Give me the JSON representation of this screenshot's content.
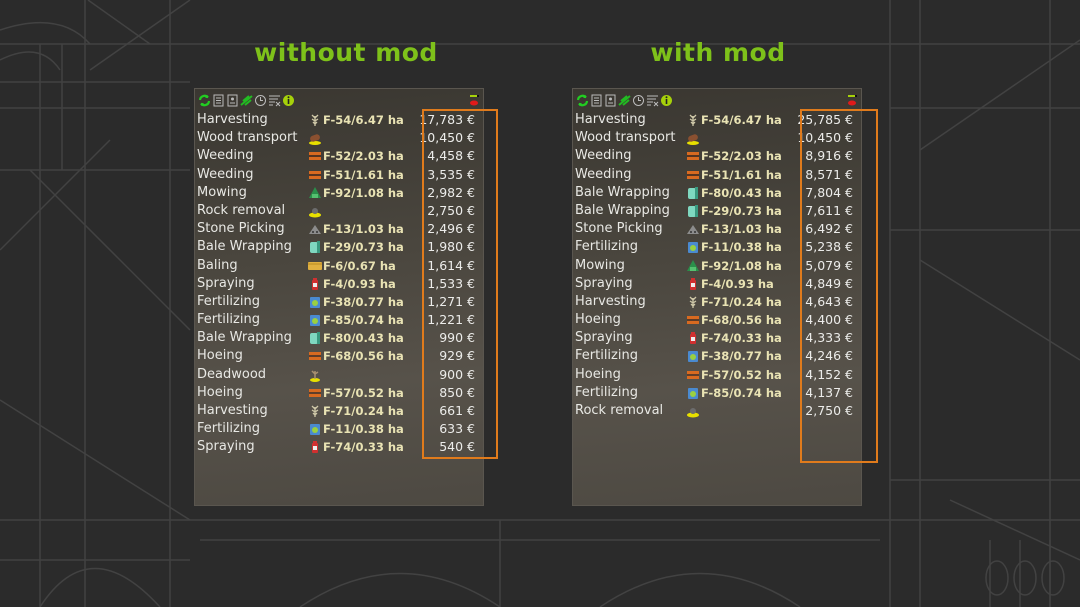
{
  "titles": {
    "left": "without mod",
    "right": "with mod"
  },
  "colors": {
    "title": "#7ec11a",
    "highlight": "#e07b1c",
    "field_text": "#e9e3b4",
    "toolbar_accent": "#22cc22",
    "info": "#a6d10a"
  },
  "toolbar_icons": [
    "refresh-icon",
    "list-icon",
    "contract-icon",
    "crop-icon",
    "clock-icon",
    "clear-filter-icon",
    "info-icon"
  ],
  "without_mod": {
    "rows": [
      {
        "task": "Harvesting",
        "icon": "harvest",
        "field": "F-54/6.47 ha",
        "amount": "17,783 €"
      },
      {
        "task": "Wood transport",
        "icon": "wood",
        "field": "",
        "amount": "10,450 €"
      },
      {
        "task": "Weeding",
        "icon": "weed",
        "field": "F-52/2.03 ha",
        "amount": "4,458 €"
      },
      {
        "task": "Weeding",
        "icon": "weed",
        "field": "F-51/1.61 ha",
        "amount": "3,535 €"
      },
      {
        "task": "Mowing",
        "icon": "mow",
        "field": "F-92/1.08 ha",
        "amount": "2,982 €"
      },
      {
        "task": "Rock removal",
        "icon": "rock",
        "field": "",
        "amount": "2,750 €"
      },
      {
        "task": "Stone Picking",
        "icon": "stone",
        "field": "F-13/1.03 ha",
        "amount": "2,496 €"
      },
      {
        "task": "Bale Wrapping",
        "icon": "wrap",
        "field": "F-29/0.73 ha",
        "amount": "1,980 €"
      },
      {
        "task": "Baling",
        "icon": "bale",
        "field": "F-6/0.67 ha",
        "amount": "1,614 €"
      },
      {
        "task": "Spraying",
        "icon": "spray",
        "field": "F-4/0.93 ha",
        "amount": "1,533 €"
      },
      {
        "task": "Fertilizing",
        "icon": "fert",
        "field": "F-38/0.77 ha",
        "amount": "1,271 €"
      },
      {
        "task": "Fertilizing",
        "icon": "fert",
        "field": "F-85/0.74 ha",
        "amount": "1,221 €"
      },
      {
        "task": "Bale Wrapping",
        "icon": "wrap",
        "field": "F-80/0.43 ha",
        "amount": "990 €"
      },
      {
        "task": "Hoeing",
        "icon": "weed",
        "field": "F-68/0.56 ha",
        "amount": "929 €"
      },
      {
        "task": "Deadwood",
        "icon": "deadwood",
        "field": "",
        "amount": "900 €"
      },
      {
        "task": "Hoeing",
        "icon": "weed",
        "field": "F-57/0.52 ha",
        "amount": "850 €"
      },
      {
        "task": "Harvesting",
        "icon": "harvest",
        "field": "F-71/0.24 ha",
        "amount": "661 €"
      },
      {
        "task": "Fertilizing",
        "icon": "fert",
        "field": "F-11/0.38 ha",
        "amount": "633 €"
      },
      {
        "task": "Spraying",
        "icon": "spray",
        "field": "F-74/0.33 ha",
        "amount": "540 €"
      }
    ]
  },
  "with_mod": {
    "rows": [
      {
        "task": "Harvesting",
        "icon": "harvest",
        "field": "F-54/6.47 ha",
        "amount": "25,785 €"
      },
      {
        "task": "Wood transport",
        "icon": "wood",
        "field": "",
        "amount": "10,450 €"
      },
      {
        "task": "Weeding",
        "icon": "weed",
        "field": "F-52/2.03 ha",
        "amount": "8,916 €"
      },
      {
        "task": "Weeding",
        "icon": "weed",
        "field": "F-51/1.61 ha",
        "amount": "8,571 €"
      },
      {
        "task": "Bale Wrapping",
        "icon": "wrap",
        "field": "F-80/0.43 ha",
        "amount": "7,804 €"
      },
      {
        "task": "Bale Wrapping",
        "icon": "wrap",
        "field": "F-29/0.73 ha",
        "amount": "7,611 €"
      },
      {
        "task": "Stone Picking",
        "icon": "stone",
        "field": "F-13/1.03 ha",
        "amount": "6,492 €"
      },
      {
        "task": "Fertilizing",
        "icon": "fert",
        "field": "F-11/0.38 ha",
        "amount": "5,238 €"
      },
      {
        "task": "Mowing",
        "icon": "mow",
        "field": "F-92/1.08 ha",
        "amount": "5,079 €"
      },
      {
        "task": "Spraying",
        "icon": "spray",
        "field": "F-4/0.93 ha",
        "amount": "4,849 €"
      },
      {
        "task": "Harvesting",
        "icon": "harvest",
        "field": "F-71/0.24 ha",
        "amount": "4,643 €"
      },
      {
        "task": "Hoeing",
        "icon": "weed",
        "field": "F-68/0.56 ha",
        "amount": "4,400 €"
      },
      {
        "task": "Spraying",
        "icon": "spray",
        "field": "F-74/0.33 ha",
        "amount": "4,333 €"
      },
      {
        "task": "Fertilizing",
        "icon": "fert",
        "field": "F-38/0.77 ha",
        "amount": "4,246 €"
      },
      {
        "task": "Hoeing",
        "icon": "weed",
        "field": "F-57/0.52 ha",
        "amount": "4,152 €"
      },
      {
        "task": "Fertilizing",
        "icon": "fert",
        "field": "F-85/0.74 ha",
        "amount": "4,137 €"
      },
      {
        "task": "Rock removal",
        "icon": "rock",
        "field": "",
        "amount": "2,750 €"
      }
    ]
  }
}
